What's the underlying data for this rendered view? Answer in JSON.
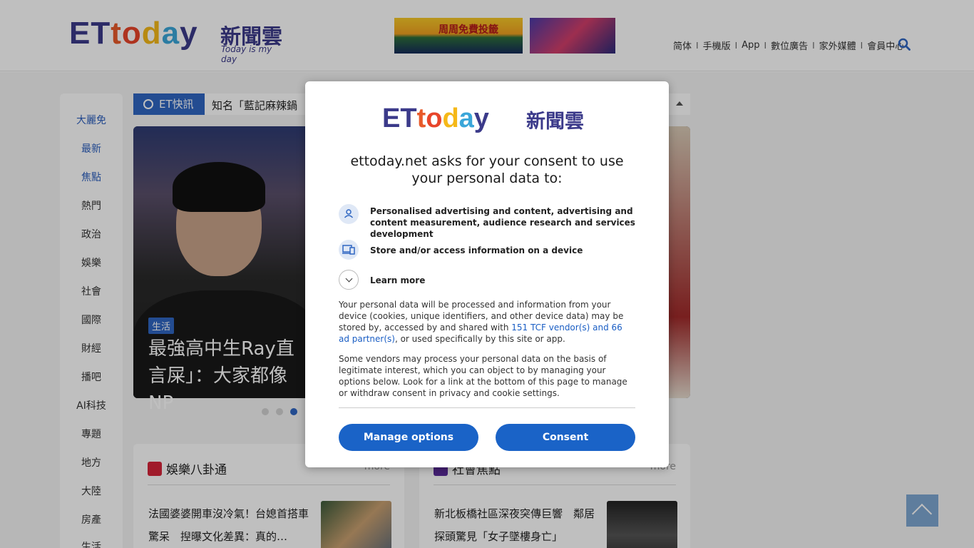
{
  "header": {
    "logo_text": "ETtoday",
    "logo_cn": "新聞雲",
    "logo_tagline": "Today is my day",
    "ad1_text": "周周免費投籤",
    "nav": [
      "简体",
      "手機版",
      "App",
      "數位廣告",
      "家外媒體",
      "會員中心"
    ]
  },
  "sidebar": {
    "items": [
      "大麗免",
      "最新",
      "焦點",
      "熱門",
      "政治",
      "娛樂",
      "社會",
      "國際",
      "財經",
      "播吧",
      "AI科技",
      "專題",
      "地方",
      "大陸",
      "房產",
      "生活"
    ]
  },
  "flash": {
    "label": "ET快訊",
    "text": "知名「藍記麻辣鍋"
  },
  "hero": {
    "tag": "生活",
    "title": "最強高中生Ray直言屎」：大家都像NP"
  },
  "boxes": [
    {
      "title": "娛樂八卦通",
      "more": "more",
      "text": "法國婆婆開車沒冷氣！台媳首搭車驚呆　揑曝文化差異：真的…"
    },
    {
      "title": "社會焦點",
      "more": "more",
      "text": "新北板橋社區深夜突傳巨響　鄰居探頭驚見「女子墜樓身亡」"
    }
  ],
  "modal": {
    "logo_et": "ETtoday",
    "logo_cn": "新聞雲",
    "heading": "ettoday.net asks for your consent to use your personal data to:",
    "purposes": [
      {
        "icon": "person-icon",
        "text": "Personalised advertising and content, advertising and content measurement, audience research and services development"
      },
      {
        "icon": "device-icon",
        "text": "Store and/or access information on a device"
      }
    ],
    "learn_more": "Learn more",
    "para1_a": "Your personal data will be processed and information from your device (cookies, unique identifiers, and other device data) may be stored by, accessed by and shared with ",
    "para1_link": "151 TCF vendor(s) and 66 ad partner(s)",
    "para1_b": ", or used specifically by this site or app.",
    "para2": "Some vendors may process your personal data on the basis of legitimate interest, which you can object to by managing your options below. Look for a link at the bottom of this page to manage or withdraw consent in privacy and cookie settings.",
    "manage_label": "Manage options",
    "consent_label": "Consent"
  },
  "colors": {
    "brand_blue": "#2f66c2",
    "button_blue": "#1a63c7",
    "logo_purple": "#3b3a8a"
  }
}
